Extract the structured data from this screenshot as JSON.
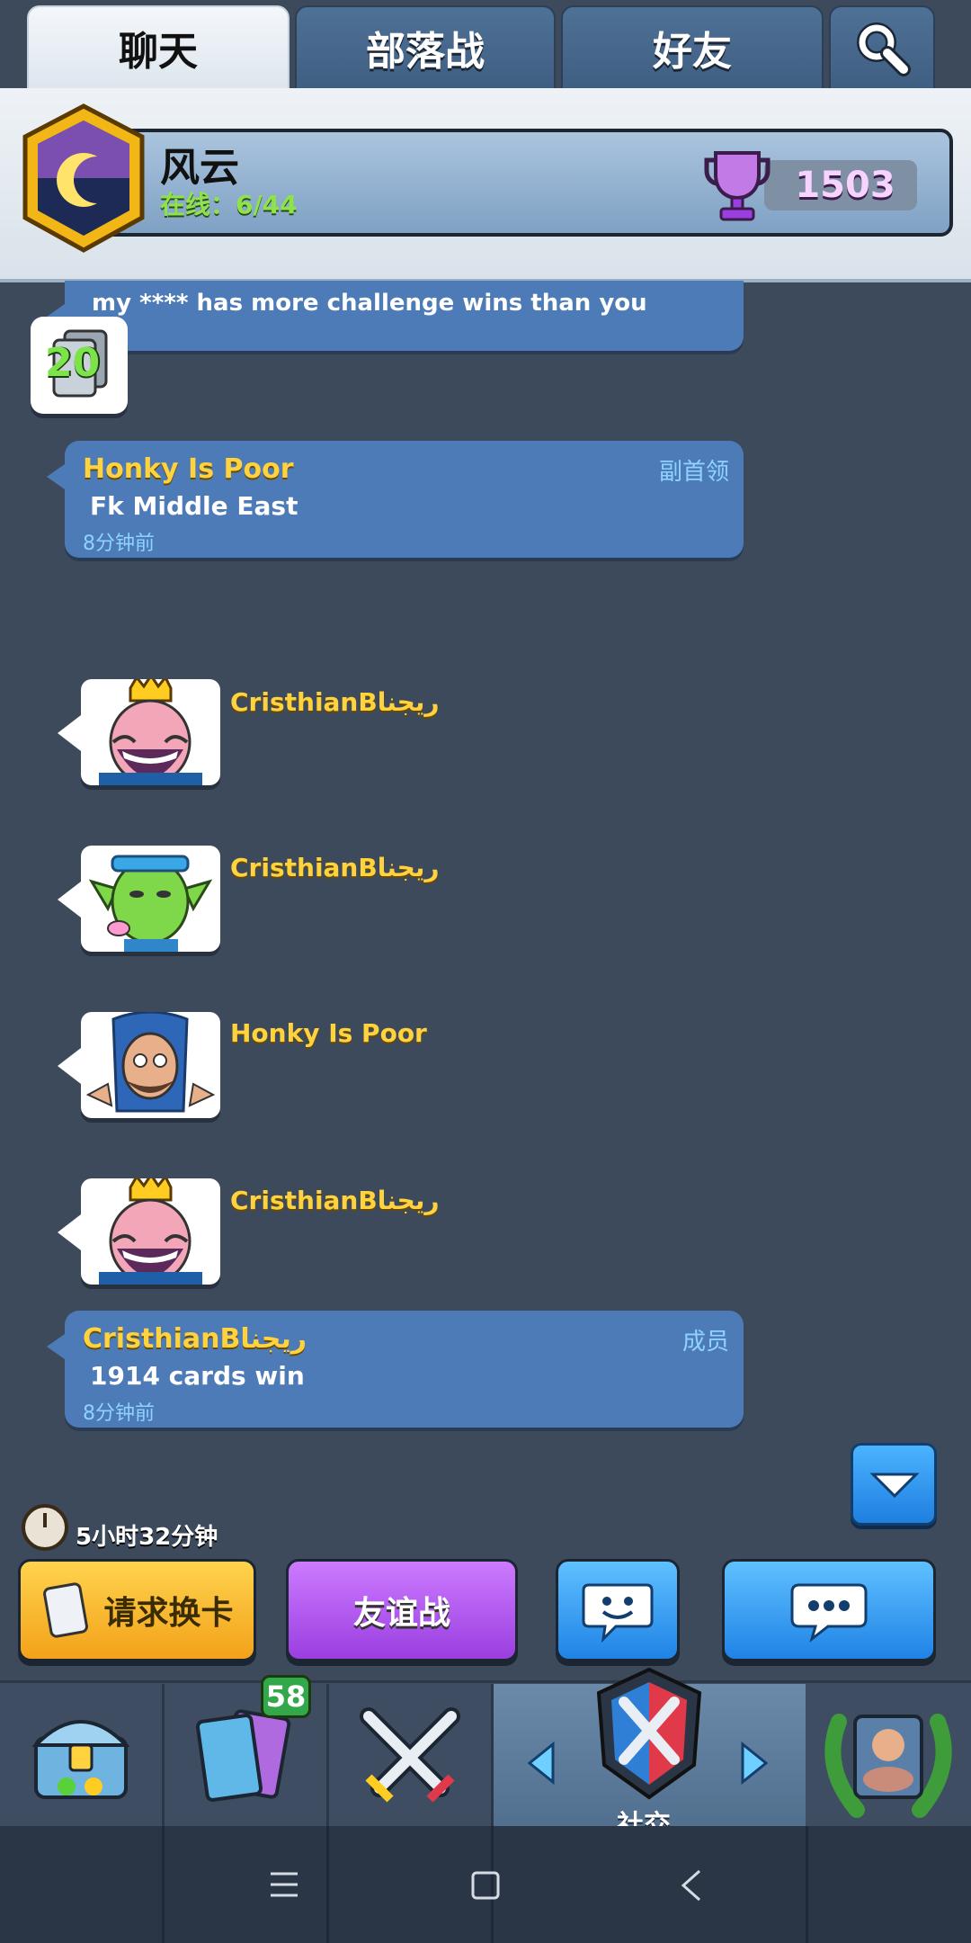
{
  "tabs": [
    {
      "label": "聊天",
      "active": true
    },
    {
      "label": "部落战",
      "active": false
    },
    {
      "label": "好友",
      "active": false
    }
  ],
  "clan": {
    "name": "风云",
    "online_label": "在线：",
    "online_value": "6/44",
    "trophies": "1503"
  },
  "chat": {
    "partial_message": "my **** has more challenge wins than you",
    "level": "20",
    "messages": [
      {
        "sender": "Honky Is Poor",
        "role": "副首领",
        "text": "Fk Middle East",
        "time": "8分钟前"
      },
      {
        "sender": "CristhianBريجنا",
        "role": "成员",
        "text": "1914 cards win",
        "time": "8分钟前"
      }
    ],
    "emotes": [
      {
        "sender": "CristhianBريجنا",
        "emote": "laughing-king-icon"
      },
      {
        "sender": "CristhianBريجنا",
        "emote": "goblin-kiss-icon"
      },
      {
        "sender": "Honky Is Poor",
        "emote": "shrugging-wizard-icon"
      },
      {
        "sender": "CristhianBريجنا",
        "emote": "laughing-king-icon"
      }
    ]
  },
  "actions": {
    "timer": "5小时32分钟",
    "request_cards": "请求换卡",
    "friendly_battle": "友谊战"
  },
  "nav": {
    "cards_badge": "58",
    "social_label": "社交"
  },
  "colors": {
    "background": "#3d4a5b",
    "bubble": "#4d7bb8",
    "name_gold": "#ffd23f",
    "online_green": "#8fe34a"
  }
}
